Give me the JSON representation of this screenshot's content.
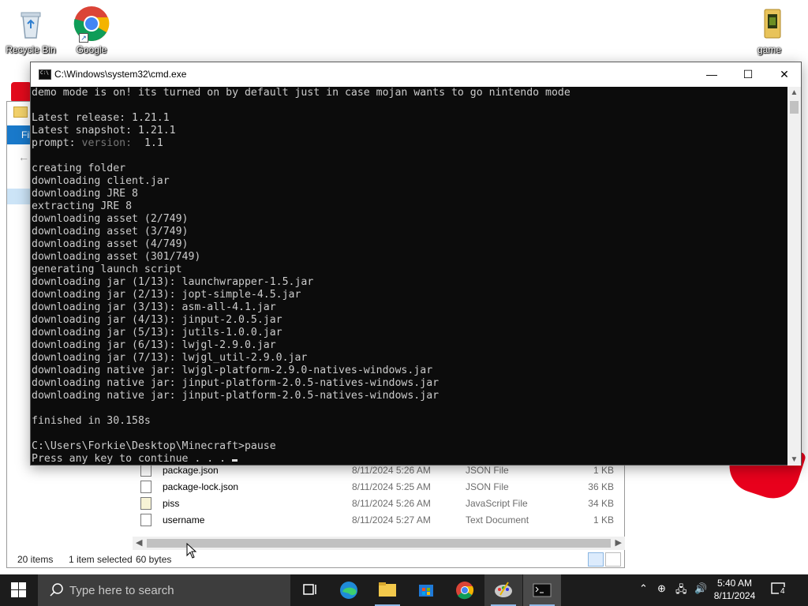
{
  "desktop": {
    "icons": [
      {
        "label": "Recycle Bin",
        "icon": "recycle-bin-icon"
      },
      {
        "label": "Google",
        "icon": "chrome-icon"
      },
      {
        "label": "game",
        "icon": "folder-icon"
      }
    ]
  },
  "cmd": {
    "title": "C:\\Windows\\system32\\cmd.exe",
    "minimize": "—",
    "maximize": "☐",
    "close": "✕",
    "prompt_value": "1.1",
    "lines": [
      "demo mode is on! its turned on by default just in case mojan wants to go nintendo mode",
      "",
      "Latest release: 1.21.1",
      "Latest snapshot: 1.21.1",
      "",
      "",
      "creating folder",
      "downloading client.jar",
      "downloading JRE 8",
      "extracting JRE 8",
      "downloading asset (2/749)",
      "downloading asset (3/749)",
      "downloading asset (4/749)",
      "downloading asset (301/749)",
      "generating launch script",
      "downloading jar (1/13): launchwrapper-1.5.jar",
      "downloading jar (2/13): jopt-simple-4.5.jar",
      "downloading jar (3/13): asm-all-4.1.jar",
      "downloading jar (4/13): jinput-2.0.5.jar",
      "downloading jar (5/13): jutils-1.0.0.jar",
      "downloading jar (6/13): lwjgl-2.9.0.jar",
      "downloading jar (7/13): lwjgl_util-2.9.0.jar",
      "downloading native jar: lwjgl-platform-2.9.0-natives-windows.jar",
      "downloading native jar: jinput-platform-2.0.5-natives-windows.jar",
      "downloading native jar: jinput-platform-2.0.5-natives-windows.jar",
      "",
      "finished in 30.158s",
      "",
      "C:\\Users\\Forkie\\Desktop\\Minecraft>pause",
      "Press any key to continue . . . "
    ],
    "prompt_label": "prompt: ",
    "prompt_hint": "version: "
  },
  "explorer": {
    "ribbon_tab": "Fil",
    "files": [
      {
        "name": "package.json",
        "date": "8/11/2024 5:26 AM",
        "type": "JSON File",
        "size": "1 KB"
      },
      {
        "name": "package-lock.json",
        "date": "8/11/2024 5:25 AM",
        "type": "JSON File",
        "size": "36 KB"
      },
      {
        "name": "piss",
        "date": "8/11/2024 5:26 AM",
        "type": "JavaScript File",
        "size": "34 KB"
      },
      {
        "name": "username",
        "date": "8/11/2024 5:27 AM",
        "type": "Text Document",
        "size": "1 KB"
      }
    ],
    "status": {
      "items": "20 items",
      "selected": "1 item selected",
      "size": "60 bytes"
    }
  },
  "taskbar": {
    "search_placeholder": "Type here to search",
    "time": "5:40 AM",
    "date": "8/11/2024",
    "notifications": "4"
  }
}
